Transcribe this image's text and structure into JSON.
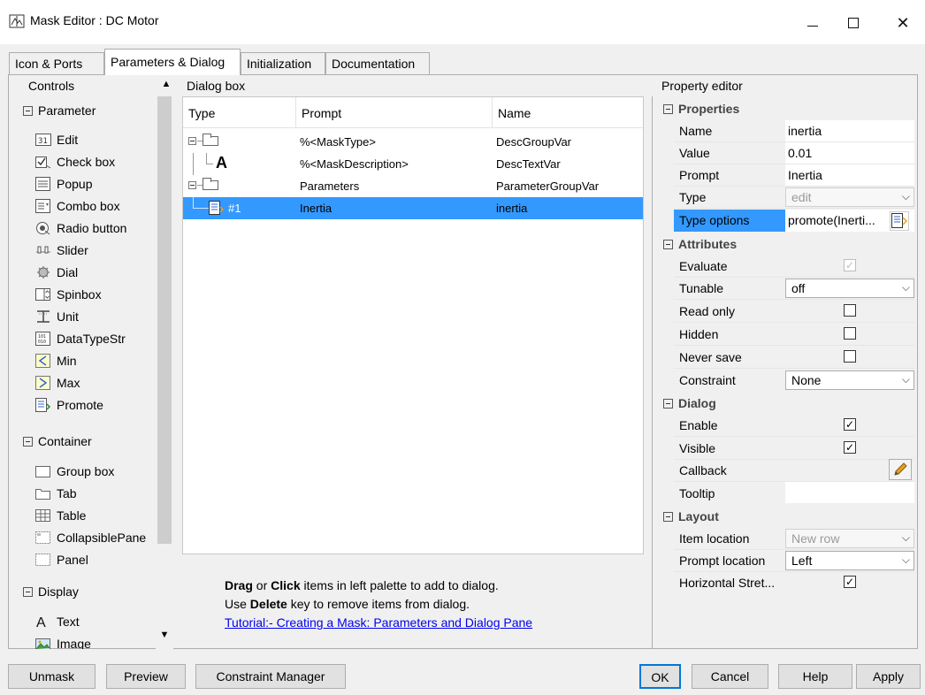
{
  "window": {
    "title": "Mask Editor : DC Motor"
  },
  "tabs": [
    "Icon & Ports",
    "Parameters & Dialog",
    "Initialization",
    "Documentation"
  ],
  "controls": {
    "header": "Controls",
    "parameter_group": "Parameter",
    "parameter_items": [
      "Edit",
      "Check box",
      "Popup",
      "Combo box",
      "Radio button",
      "Slider",
      "Dial",
      "Spinbox",
      "Unit",
      "DataTypeStr",
      "Min",
      "Max",
      "Promote"
    ],
    "container_group": "Container",
    "container_items": [
      "Group box",
      "Tab",
      "Table",
      "CollapsiblePane",
      "Panel"
    ],
    "display_group": "Display",
    "display_items": [
      "Text",
      "Image"
    ]
  },
  "dialog_box": {
    "label": "Dialog box",
    "columns": [
      "Type",
      "Prompt",
      "Name"
    ],
    "rows": [
      {
        "type": "",
        "prompt": "%<MaskType>",
        "name": "DescGroupVar"
      },
      {
        "type": "A",
        "prompt": "%<MaskDescription>",
        "name": "DescTextVar"
      },
      {
        "type": "",
        "prompt": "Parameters",
        "name": "ParameterGroupVar"
      },
      {
        "type": "#1",
        "prompt": "Inertia",
        "name": "inertia"
      }
    ],
    "hint_drag": "Drag",
    "hint_or": " or ",
    "hint_click": "Click",
    "hint_rest1": " items in left palette to add to dialog.",
    "hint_use": "Use ",
    "hint_delete": "Delete",
    "hint_rest2": " key to remove items from dialog.",
    "tutorial_link": "Tutorial:- Creating a Mask: Parameters and Dialog Pane"
  },
  "property_editor": {
    "label": "Property editor",
    "properties_section": "Properties",
    "name_label": "Name",
    "name_value": "inertia",
    "value_label": "Value",
    "value_value": "0.01",
    "prompt_label": "Prompt",
    "prompt_value": "Inertia",
    "type_label": "Type",
    "type_value": "edit",
    "type_options_label": "Type options",
    "type_options_value": "promote(Inerti...",
    "attributes_section": "Attributes",
    "evaluate_label": "Evaluate",
    "evaluate_checked": true,
    "tunable_label": "Tunable",
    "tunable_value": "off",
    "read_only_label": "Read only",
    "read_only_checked": false,
    "hidden_label": "Hidden",
    "hidden_checked": false,
    "never_save_label": "Never save",
    "never_save_checked": false,
    "constraint_label": "Constraint",
    "constraint_value": "None",
    "dialog_section": "Dialog",
    "enable_label": "Enable",
    "enable_checked": true,
    "visible_label": "Visible",
    "visible_checked": true,
    "callback_label": "Callback",
    "tooltip_label": "Tooltip",
    "layout_section": "Layout",
    "item_location_label": "Item location",
    "item_location_value": "New row",
    "prompt_location_label": "Prompt location",
    "prompt_location_value": "Left",
    "horizontal_stretch_label": "Horizontal Stret...",
    "horizontal_stretch_checked": true
  },
  "buttons": {
    "unmask": "Unmask",
    "preview": "Preview",
    "constraint_manager": "Constraint Manager",
    "ok": "OK",
    "cancel": "Cancel",
    "help": "Help",
    "apply": "Apply"
  },
  "colors": {
    "selection": "#3399ff",
    "link": "#0000ee",
    "focus": "#0078d7"
  }
}
